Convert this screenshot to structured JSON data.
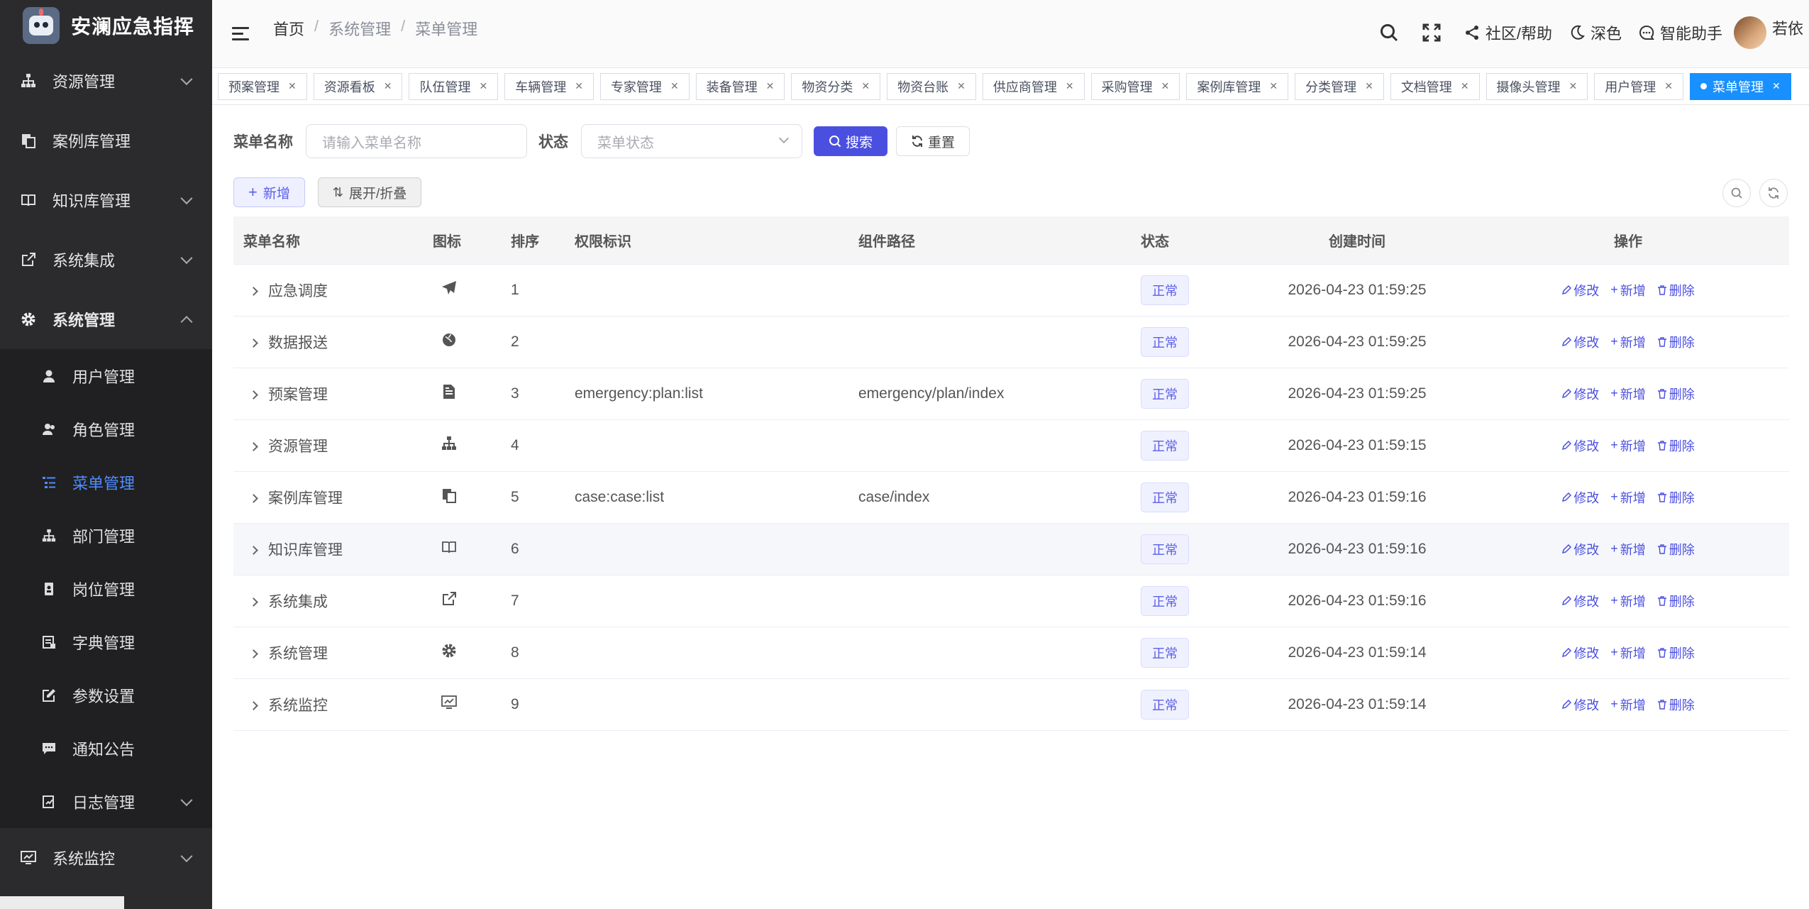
{
  "app": {
    "title": "安澜应急指挥"
  },
  "sidebar": {
    "items": [
      {
        "label": "资源管理",
        "icon": "sitemap-icon",
        "expandable": true
      },
      {
        "label": "案例库管理",
        "icon": "copy-icon",
        "expandable": false
      },
      {
        "label": "知识库管理",
        "icon": "book-icon",
        "expandable": true
      },
      {
        "label": "系统集成",
        "icon": "external-link-icon",
        "expandable": true
      },
      {
        "label": "系统管理",
        "icon": "gear-icon",
        "expandable": true,
        "expanded": true
      }
    ],
    "sub_items": [
      {
        "label": "用户管理",
        "icon": "user-icon"
      },
      {
        "label": "角色管理",
        "icon": "user-group-icon"
      },
      {
        "label": "菜单管理",
        "icon": "menu-tree-icon",
        "active": true
      },
      {
        "label": "部门管理",
        "icon": "sitemap-icon"
      },
      {
        "label": "岗位管理",
        "icon": "id-card-icon"
      },
      {
        "label": "字典管理",
        "icon": "dictionary-icon"
      },
      {
        "label": "参数设置",
        "icon": "edit-icon"
      },
      {
        "label": "通知公告",
        "icon": "message-icon"
      },
      {
        "label": "日志管理",
        "icon": "log-icon",
        "expandable": true
      }
    ],
    "bottom_item": {
      "label": "系统监控",
      "icon": "monitor-icon",
      "expandable": true
    }
  },
  "header": {
    "breadcrumb": [
      "首页",
      "系统管理",
      "菜单管理"
    ],
    "community_help": "社区/帮助",
    "theme": "深色",
    "assistant": "智能助手",
    "username": "若依"
  },
  "tabs": [
    {
      "label": "预案管理"
    },
    {
      "label": "资源看板"
    },
    {
      "label": "队伍管理"
    },
    {
      "label": "车辆管理"
    },
    {
      "label": "专家管理"
    },
    {
      "label": "装备管理"
    },
    {
      "label": "物资分类"
    },
    {
      "label": "物资台账"
    },
    {
      "label": "供应商管理"
    },
    {
      "label": "采购管理"
    },
    {
      "label": "案例库管理"
    },
    {
      "label": "分类管理"
    },
    {
      "label": "文档管理"
    },
    {
      "label": "摄像头管理"
    },
    {
      "label": "用户管理"
    },
    {
      "label": "菜单管理",
      "active": true
    }
  ],
  "search": {
    "menu_name_label": "菜单名称",
    "menu_name_placeholder": "请输入菜单名称",
    "status_label": "状态",
    "status_placeholder": "菜单状态",
    "search_button": "搜索",
    "reset_button": "重置"
  },
  "toolbar": {
    "add_button": "新增",
    "expand_button": "展开/折叠"
  },
  "table": {
    "columns": [
      "菜单名称",
      "图标",
      "排序",
      "权限标识",
      "组件路径",
      "状态",
      "创建时间",
      "操作"
    ],
    "rows": [
      {
        "name": "应急调度",
        "icon": "paper-plane-icon",
        "order": "1",
        "perm": "",
        "path": "",
        "status": "正常",
        "created": "2026-04-23 01:59:25"
      },
      {
        "name": "数据报送",
        "icon": "globe-icon",
        "order": "2",
        "perm": "",
        "path": "",
        "status": "正常",
        "created": "2026-04-23 01:59:25"
      },
      {
        "name": "预案管理",
        "icon": "document-icon",
        "order": "3",
        "perm": "emergency:plan:list",
        "path": "emergency/plan/index",
        "status": "正常",
        "created": "2026-04-23 01:59:25"
      },
      {
        "name": "资源管理",
        "icon": "sitemap-icon",
        "order": "4",
        "perm": "",
        "path": "",
        "status": "正常",
        "created": "2026-04-23 01:59:15"
      },
      {
        "name": "案例库管理",
        "icon": "copy-icon",
        "order": "5",
        "perm": "case:case:list",
        "path": "case/index",
        "status": "正常",
        "created": "2026-04-23 01:59:16"
      },
      {
        "name": "知识库管理",
        "icon": "book-icon",
        "order": "6",
        "perm": "",
        "path": "",
        "status": "正常",
        "created": "2026-04-23 01:59:16",
        "hover": true
      },
      {
        "name": "系统集成",
        "icon": "external-link-icon",
        "order": "7",
        "perm": "",
        "path": "",
        "status": "正常",
        "created": "2026-04-23 01:59:16"
      },
      {
        "name": "系统管理",
        "icon": "gear-icon",
        "order": "8",
        "perm": "",
        "path": "",
        "status": "正常",
        "created": "2026-04-23 01:59:14"
      },
      {
        "name": "系统监控",
        "icon": "monitor-icon",
        "order": "9",
        "perm": "",
        "path": "",
        "status": "正常",
        "created": "2026-04-23 01:59:14"
      }
    ],
    "ops": {
      "edit": "修改",
      "add": "新增",
      "delete": "删除"
    }
  },
  "colors": {
    "primary": "#4b4fe0",
    "active_tab": "#1890ff",
    "sidebar_bg": "#2b2b2e",
    "sidebar_active": "#4f8dff"
  }
}
